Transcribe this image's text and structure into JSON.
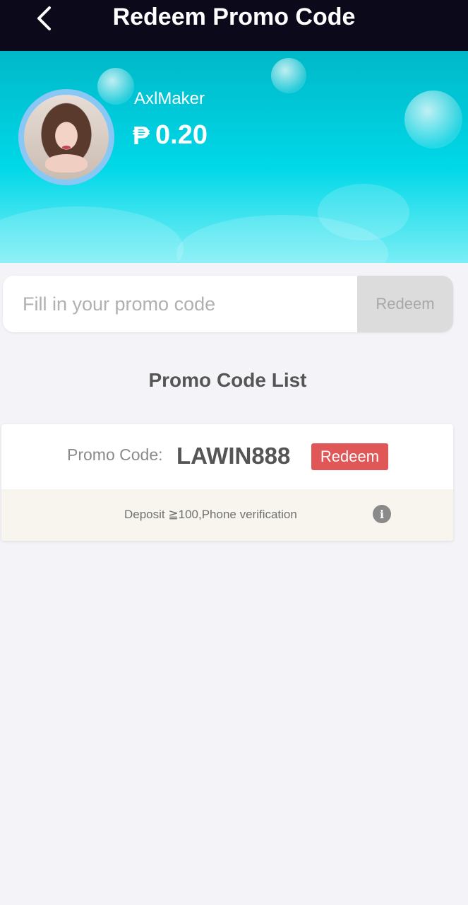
{
  "header": {
    "title": "Redeem Promo Code",
    "back_icon": "chevron-left-icon"
  },
  "profile": {
    "username": "AxlMaker",
    "currency_symbol": "₱",
    "balance": "0.20"
  },
  "promo_input": {
    "value": "",
    "placeholder": "Fill in your promo code",
    "button_label": "Redeem"
  },
  "promo_list": {
    "title": "Promo Code List",
    "items": [
      {
        "label": "Promo Code:",
        "code": "LAWIN888",
        "button_label": "Redeem",
        "condition": "Deposit ≧100,Phone verification",
        "info_icon": "i"
      }
    ]
  },
  "colors": {
    "header_bg": "#0c0a1a",
    "hero_accent": "#00d8e8",
    "redeem_accent": "#e05757",
    "disabled_button": "#dcdcdc"
  }
}
